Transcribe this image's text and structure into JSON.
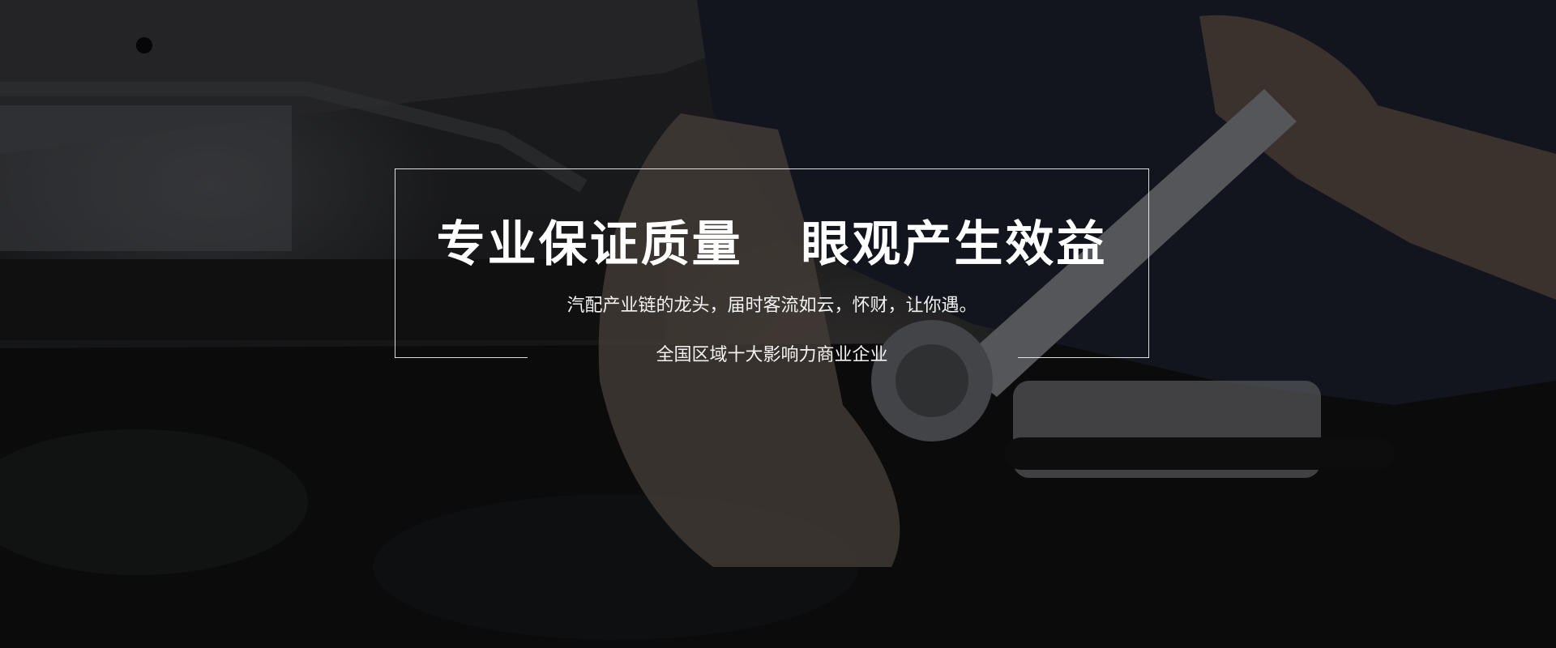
{
  "banner": {
    "headline_part1": "专业保证质量",
    "headline_part2": "眼观产生效益",
    "subline": "汽配产业链的龙头，届时客流如云，怀财，让你遇。",
    "tagline": "全国区域十大影响力商业企业"
  }
}
